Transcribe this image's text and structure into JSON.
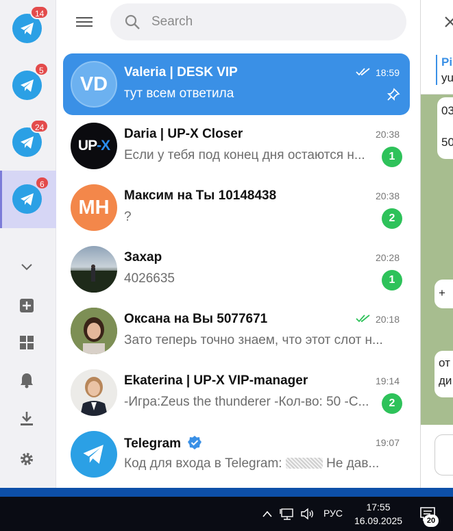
{
  "rail": {
    "accounts": [
      {
        "badge": "14"
      },
      {
        "badge": "5"
      },
      {
        "badge": "24"
      },
      {
        "badge": "6"
      }
    ],
    "icons": [
      "chevron-down-icon",
      "add-icon",
      "grid-icon",
      "bell-icon",
      "download-icon",
      "gear-icon"
    ]
  },
  "search": {
    "placeholder": "Search"
  },
  "chats": [
    {
      "name": "Valeria | DESK VIP",
      "message": "тут всем ответила",
      "time": "18:59",
      "avatar_text": "VD",
      "read": true,
      "pinned": true
    },
    {
      "name": "Daria | UP-X Closer",
      "message": "Если у тебя под конец дня остаются н...",
      "time": "20:38",
      "avatar_text": "UP-X",
      "unread": "1"
    },
    {
      "name": "Максим на Ты 10148438",
      "message": "?",
      "time": "20:38",
      "avatar_text": "MH",
      "unread": "2"
    },
    {
      "name": "Захар",
      "message": "4026635",
      "time": "20:28",
      "unread": "1"
    },
    {
      "name": "Оксана на Вы 5077671",
      "message": "Зато теперь точно знаем, что этот слот н...",
      "time": "20:18",
      "read": true
    },
    {
      "name": "Ekaterina | UP-X VIP-manager",
      "message": "-Игра:Zeus the thunderer -Кол-во: 50 -С...",
      "time": "19:14",
      "unread": "2"
    },
    {
      "name": "Telegram",
      "message_before": "Код для входа в Telegram:",
      "message_after": "Не дав...",
      "time": "19:07",
      "verified": true
    }
  ],
  "conversation": {
    "pinned_title": "Pi",
    "pinned_text": "yu",
    "bubbles": [
      "03",
      "50",
      "+",
      "от",
      "ди"
    ]
  },
  "taskbar": {
    "lang": "РУС",
    "time": "17:55",
    "date": "16.09.2025",
    "notification_count": "20"
  }
}
